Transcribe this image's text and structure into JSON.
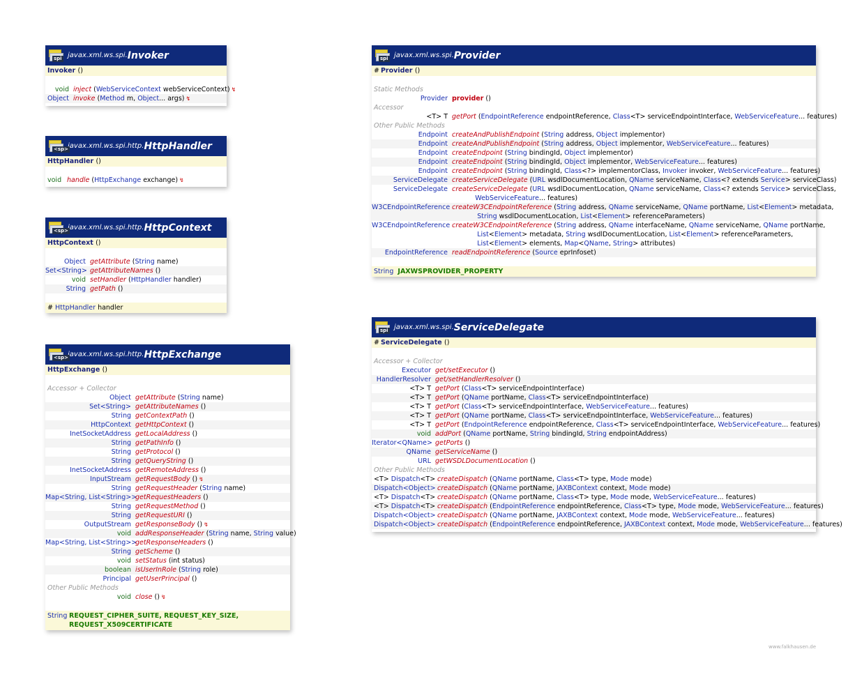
{
  "invoker": {
    "package": "javax.xml.ws.spi.",
    "name": "Invoker",
    "icon_label": "spi",
    "ctor": "Invoker",
    "methods": [
      {
        "ret": "void",
        "name": "inject",
        "params": "(WebServiceContext webServiceContext)",
        "throws": true
      },
      {
        "ret": "Object",
        "name": "invoke",
        "params": "(Method m, Object... args)",
        "throws": true
      }
    ]
  },
  "httphandler": {
    "package": "javax.xml.ws.spi.http.",
    "name": "HttpHandler",
    "icon_label": "<sp>",
    "ctor": "HttpHandler",
    "methods": [
      {
        "ret": "void",
        "name": "handle",
        "params": "(HttpExchange exchange)",
        "throws": true
      }
    ]
  },
  "httpcontext": {
    "package": "javax.xml.ws.spi.http.",
    "name": "HttpContext",
    "icon_label": "<sp>",
    "ctor": "HttpContext",
    "methods": [
      {
        "ret": "Object",
        "name": "getAttribute",
        "params": "(String name)"
      },
      {
        "ret": "Set<String>",
        "name": "getAttributeNames",
        "params": "()"
      },
      {
        "ret": "void",
        "name": "setHandler",
        "params": "(HttpHandler handler)"
      },
      {
        "ret": "String",
        "name": "getPath",
        "params": "()"
      }
    ],
    "field": {
      "prefix": "#",
      "type": "HttpHandler",
      "name": "handler"
    }
  },
  "httpexchange": {
    "package": "javax.xml.ws.spi.http.",
    "name": "HttpExchange",
    "icon_label": "<sp>",
    "ctor": "HttpExchange",
    "section1": "Accessor + Collector",
    "methods": [
      {
        "ret": "Object",
        "name": "getAttribute",
        "params": "(String name)"
      },
      {
        "ret": "Set<String>",
        "name": "getAttributeNames",
        "params": "()"
      },
      {
        "ret": "String",
        "name": "getContextPath",
        "params": "()"
      },
      {
        "ret": "HttpContext",
        "name": "getHttpContext",
        "params": "()"
      },
      {
        "ret": "InetSocketAddress",
        "name": "getLocalAddress",
        "params": "()"
      },
      {
        "ret": "String",
        "name": "getPathInfo",
        "params": "()"
      },
      {
        "ret": "String",
        "name": "getProtocol",
        "params": "()"
      },
      {
        "ret": "String",
        "name": "getQueryString",
        "params": "()"
      },
      {
        "ret": "InetSocketAddress",
        "name": "getRemoteAddress",
        "params": "()"
      },
      {
        "ret": "InputStream",
        "name": "getRequestBody",
        "params": "()",
        "throws": true
      },
      {
        "ret": "String",
        "name": "getRequestHeader",
        "params": "(String name)"
      },
      {
        "ret": "Map<String, List<String>>",
        "name": "getRequestHeaders",
        "params": "()"
      },
      {
        "ret": "String",
        "name": "getRequestMethod",
        "params": "()"
      },
      {
        "ret": "String",
        "name": "getRequestURI",
        "params": "()"
      },
      {
        "ret": "OutputStream",
        "name": "getResponseBody",
        "params": "()",
        "throws": true
      },
      {
        "ret": "void",
        "name": "addResponseHeader",
        "params": "(String name, String value)"
      },
      {
        "ret": "Map<String, List<String>>",
        "name": "getResponseHeaders",
        "params": "()"
      },
      {
        "ret": "String",
        "name": "getScheme",
        "params": "()"
      },
      {
        "ret": "void",
        "name": "setStatus",
        "params": "(int status)"
      },
      {
        "ret": "boolean",
        "name": "isUserInRole",
        "params": "(String role)"
      },
      {
        "ret": "Principal",
        "name": "getUserPrincipal",
        "params": "()"
      }
    ],
    "section2": "Other Public Methods",
    "methods2": [
      {
        "ret": "void",
        "name": "close",
        "params": "()",
        "throws": true
      }
    ],
    "field_type": "String",
    "field_line1": "REQUEST_CIPHER_SUITE, REQUEST_KEY_SIZE,",
    "field_line2": "REQUEST_X509CERTIFICATE"
  },
  "provider": {
    "package": "javax.xml.ws.spi.",
    "name": "Provider",
    "icon_label": "spi",
    "ctor": "Provider",
    "section_static": "Static Methods",
    "static_methods": [
      {
        "ret": "Provider",
        "name": "provider",
        "params": "()"
      }
    ],
    "section_accessor": "Accessor",
    "accessor_methods": [
      {
        "ret": "<T> T",
        "name": "getPort",
        "params": "(EndpointReference endpointReference, Class<T> serviceEndpointInterface, WebServiceFeature... features)"
      }
    ],
    "section_other": "Other Public Methods",
    "other_methods": [
      {
        "ret": "Endpoint",
        "name": "createAndPublishEndpoint",
        "params": "(String address, Object implementor)",
        "italic": true
      },
      {
        "ret": "Endpoint",
        "name": "createAndPublishEndpoint",
        "params": "(String address, Object implementor, WebServiceFeature... features)"
      },
      {
        "ret": "Endpoint",
        "name": "createEndpoint",
        "params": "(String bindingId, Object implementor)",
        "italic": true
      },
      {
        "ret": "Endpoint",
        "name": "createEndpoint",
        "params": "(String bindingId, Object implementor, WebServiceFeature... features)"
      },
      {
        "ret": "Endpoint",
        "name": "createEndpoint",
        "params": "(String bindingId, Class<?> implementorClass, Invoker invoker, WebServiceFeature... features)"
      },
      {
        "ret": "ServiceDelegate",
        "name": "createServiceDelegate",
        "params": "(URL wsdlDocumentLocation, QName serviceName, Class<? extends Service> serviceClass)",
        "italic": true
      },
      {
        "ret": "ServiceDelegate",
        "name": "createServiceDelegate",
        "params": "(URL wsdlDocumentLocation, QName serviceName, Class<? extends Service> serviceClass,\n WebServiceFeature... features)"
      },
      {
        "ret": "W3CEndpointReference",
        "name": "createW3CEndpointReference",
        "params": "(String address, QName serviceName, QName portName, List<Element> metadata,\n String wsdlDocumentLocation, List<Element> referenceParameters)",
        "italic": true
      },
      {
        "ret": "W3CEndpointReference",
        "name": "createW3CEndpointReference",
        "params": "(String address, QName interfaceName, QName serviceName, QName portName,\n List<Element> metadata, String wsdlDocumentLocation, List<Element> referenceParameters,\n List<Element> elements, Map<QName, String> attributes)"
      },
      {
        "ret": "EndpointReference",
        "name": "readEndpointReference",
        "params": "(Source eprInfoset)",
        "italic": true
      }
    ],
    "field_type": "String",
    "field_name": "JAXWSPROVIDER_PROPERTY"
  },
  "servicedelegate": {
    "package": "javax.xml.ws.spi.",
    "name": "ServiceDelegate",
    "icon_label": "spi",
    "ctor": "ServiceDelegate",
    "section1": "Accessor + Collector",
    "methods": [
      {
        "ret": "Executor",
        "name": "get/setExecutor",
        "params": "()"
      },
      {
        "ret": "HandlerResolver",
        "name": "get/setHandlerResolver",
        "params": "()"
      },
      {
        "ret": "<T> T",
        "name": "getPort",
        "params": "(Class<T> serviceEndpointInterface)"
      },
      {
        "ret": "<T> T",
        "name": "getPort",
        "params": "(QName portName, Class<T> serviceEndpointInterface)"
      },
      {
        "ret": "<T> T",
        "name": "getPort",
        "params": "(Class<T> serviceEndpointInterface, WebServiceFeature... features)"
      },
      {
        "ret": "<T> T",
        "name": "getPort",
        "params": "(QName portName, Class<T> serviceEndpointInterface, WebServiceFeature... features)"
      },
      {
        "ret": "<T> T",
        "name": "getPort",
        "params": "(EndpointReference endpointReference, Class<T> serviceEndpointInterface, WebServiceFeature... features)"
      },
      {
        "ret": "void",
        "name": "addPort",
        "params": "(QName portName, String bindingId, String endpointAddress)"
      },
      {
        "ret": "Iterator<QName>",
        "name": "getPorts",
        "params": "()"
      },
      {
        "ret": "QName",
        "name": "getServiceName",
        "params": "()"
      },
      {
        "ret": "URL",
        "name": "getWSDLDocumentLocation",
        "params": "()"
      }
    ],
    "section2": "Other Public Methods",
    "methods2": [
      {
        "ret": "<T> Dispatch<T>",
        "name": "createDispatch",
        "params": "(QName portName, Class<T> type, Mode mode)"
      },
      {
        "ret": "Dispatch<Object>",
        "name": "createDispatch",
        "params": "(QName portName, JAXBContext context, Mode mode)"
      },
      {
        "ret": "<T> Dispatch<T>",
        "name": "createDispatch",
        "params": "(QName portName, Class<T> type, Mode mode, WebServiceFeature... features)"
      },
      {
        "ret": "<T> Dispatch<T>",
        "name": "createDispatch",
        "params": "(EndpointReference endpointReference, Class<T> type, Mode mode, WebServiceFeature... features)"
      },
      {
        "ret": "Dispatch<Object>",
        "name": "createDispatch",
        "params": "(QName portName, JAXBContext context, Mode mode, WebServiceFeature... features)"
      },
      {
        "ret": "Dispatch<Object>",
        "name": "createDispatch",
        "params": "(EndpointReference endpointReference, JAXBContext context, Mode mode, WebServiceFeature... features)"
      }
    ]
  },
  "footer": "www.falkhausen.de",
  "colors": {
    "header": "#0f2a7a",
    "constructor_bg": "#fbf8d8",
    "method": "#c00010",
    "type": "#1a2fb0",
    "void": "#1a6e1a",
    "constant": "#1a7a00"
  }
}
